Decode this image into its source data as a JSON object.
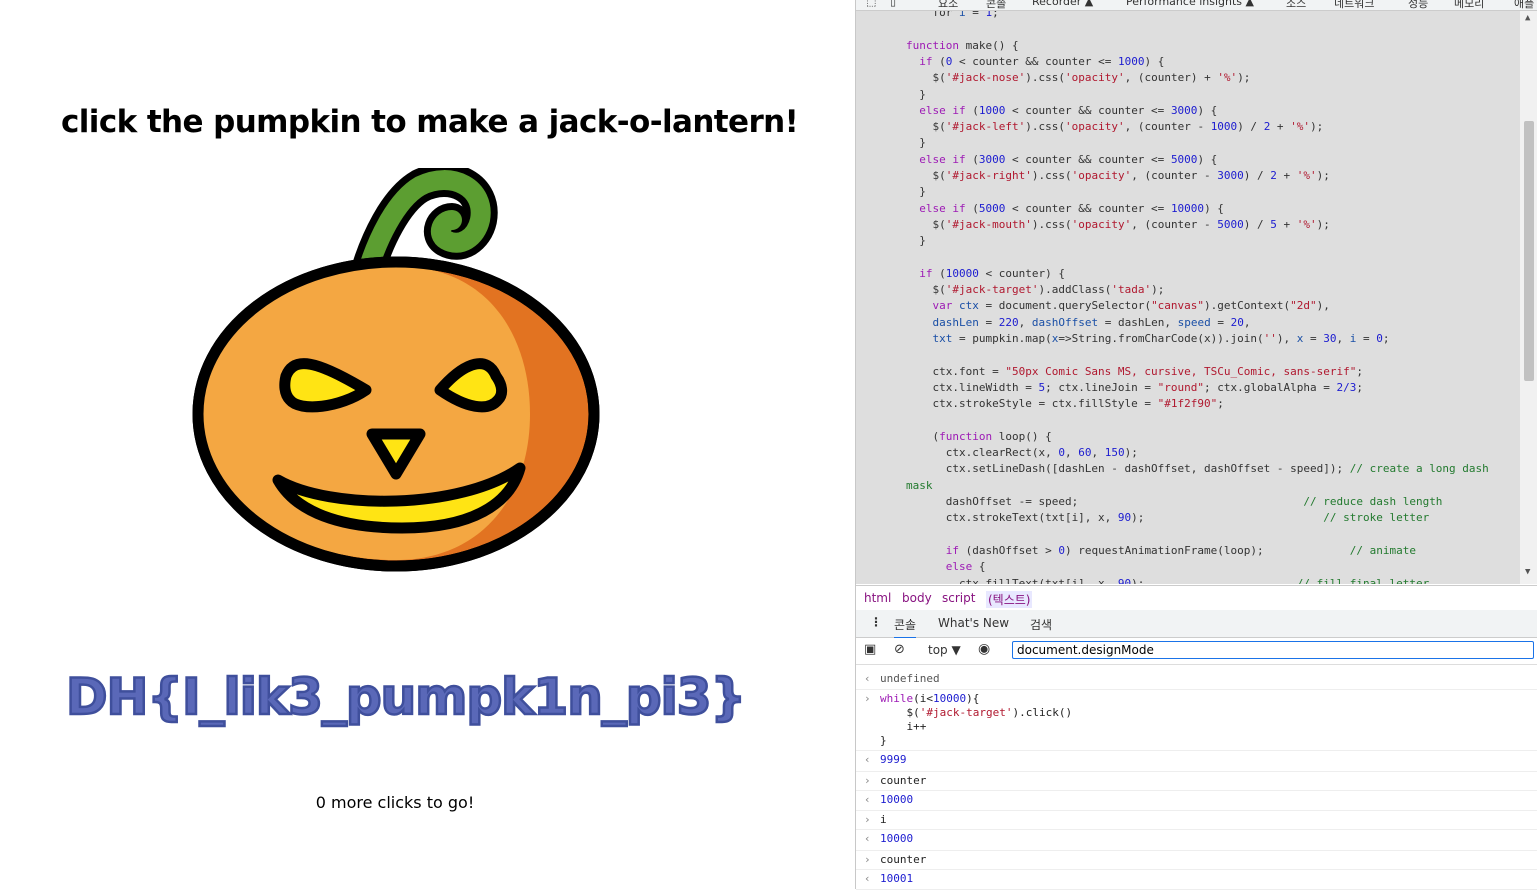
{
  "page": {
    "heading": "click the pumpkin to make a jack-o-lantern!",
    "flag_text": "DH{I_lik3_pumpk1n_pi3}",
    "clicks_text": "0 more clicks to go!",
    "colors": {
      "pumpkin_orange": "#f4a742",
      "pumpkin_shade": "#e27321",
      "stem_green": "#5c9e31",
      "eyes_yellow": "#ffe414",
      "outline": "#000000",
      "flag_color": "#1f2f90"
    }
  },
  "devtools": {
    "top_tabs": [
      "요소",
      "콘솔",
      "Recorder ▲",
      "Performance insights ▲",
      "소스",
      "네트워크",
      "성능",
      "메모리",
      "애플"
    ],
    "source_lines": [
      [
        {
          "t": "    for ",
          "c": ""
        },
        {
          "t": "i",
          "c": "vr"
        },
        {
          "t": " = ",
          "c": ""
        },
        {
          "t": "1",
          "c": "nu"
        },
        {
          "t": ";",
          "c": ""
        }
      ],
      [
        {
          "t": "",
          "c": ""
        }
      ],
      [
        {
          "t": "function",
          "c": "kw"
        },
        {
          "t": " make() {",
          "c": ""
        }
      ],
      [
        {
          "t": "  ",
          "c": ""
        },
        {
          "t": "if",
          "c": "kw"
        },
        {
          "t": " (",
          "c": ""
        },
        {
          "t": "0",
          "c": "nu"
        },
        {
          "t": " < counter && counter <= ",
          "c": ""
        },
        {
          "t": "1000",
          "c": "nu"
        },
        {
          "t": ") {",
          "c": ""
        }
      ],
      [
        {
          "t": "    $(",
          "c": ""
        },
        {
          "t": "'#jack-nose'",
          "c": "st"
        },
        {
          "t": ").css(",
          "c": ""
        },
        {
          "t": "'opacity'",
          "c": "st"
        },
        {
          "t": ", (counter) + ",
          "c": ""
        },
        {
          "t": "'%'",
          "c": "st"
        },
        {
          "t": ");",
          "c": ""
        }
      ],
      [
        {
          "t": "  }",
          "c": ""
        }
      ],
      [
        {
          "t": "  ",
          "c": ""
        },
        {
          "t": "else if",
          "c": "kw"
        },
        {
          "t": " (",
          "c": ""
        },
        {
          "t": "1000",
          "c": "nu"
        },
        {
          "t": " < counter && counter <= ",
          "c": ""
        },
        {
          "t": "3000",
          "c": "nu"
        },
        {
          "t": ") {",
          "c": ""
        }
      ],
      [
        {
          "t": "    $(",
          "c": ""
        },
        {
          "t": "'#jack-left'",
          "c": "st"
        },
        {
          "t": ").css(",
          "c": ""
        },
        {
          "t": "'opacity'",
          "c": "st"
        },
        {
          "t": ", (counter - ",
          "c": ""
        },
        {
          "t": "1000",
          "c": "nu"
        },
        {
          "t": ") / ",
          "c": ""
        },
        {
          "t": "2",
          "c": "nu"
        },
        {
          "t": " + ",
          "c": ""
        },
        {
          "t": "'%'",
          "c": "st"
        },
        {
          "t": ");",
          "c": ""
        }
      ],
      [
        {
          "t": "  }",
          "c": ""
        }
      ],
      [
        {
          "t": "  ",
          "c": ""
        },
        {
          "t": "else if",
          "c": "kw"
        },
        {
          "t": " (",
          "c": ""
        },
        {
          "t": "3000",
          "c": "nu"
        },
        {
          "t": " < counter && counter <= ",
          "c": ""
        },
        {
          "t": "5000",
          "c": "nu"
        },
        {
          "t": ") {",
          "c": ""
        }
      ],
      [
        {
          "t": "    $(",
          "c": ""
        },
        {
          "t": "'#jack-right'",
          "c": "st"
        },
        {
          "t": ").css(",
          "c": ""
        },
        {
          "t": "'opacity'",
          "c": "st"
        },
        {
          "t": ", (counter - ",
          "c": ""
        },
        {
          "t": "3000",
          "c": "nu"
        },
        {
          "t": ") / ",
          "c": ""
        },
        {
          "t": "2",
          "c": "nu"
        },
        {
          "t": " + ",
          "c": ""
        },
        {
          "t": "'%'",
          "c": "st"
        },
        {
          "t": ");",
          "c": ""
        }
      ],
      [
        {
          "t": "  }",
          "c": ""
        }
      ],
      [
        {
          "t": "  ",
          "c": ""
        },
        {
          "t": "else if",
          "c": "kw"
        },
        {
          "t": " (",
          "c": ""
        },
        {
          "t": "5000",
          "c": "nu"
        },
        {
          "t": " < counter && counter <= ",
          "c": ""
        },
        {
          "t": "10000",
          "c": "nu"
        },
        {
          "t": ") {",
          "c": ""
        }
      ],
      [
        {
          "t": "    $(",
          "c": ""
        },
        {
          "t": "'#jack-mouth'",
          "c": "st"
        },
        {
          "t": ").css(",
          "c": ""
        },
        {
          "t": "'opacity'",
          "c": "st"
        },
        {
          "t": ", (counter - ",
          "c": ""
        },
        {
          "t": "5000",
          "c": "nu"
        },
        {
          "t": ") / ",
          "c": ""
        },
        {
          "t": "5",
          "c": "nu"
        },
        {
          "t": " + ",
          "c": ""
        },
        {
          "t": "'%'",
          "c": "st"
        },
        {
          "t": ");",
          "c": ""
        }
      ],
      [
        {
          "t": "  }",
          "c": ""
        }
      ],
      [
        {
          "t": "",
          "c": ""
        }
      ],
      [
        {
          "t": "  ",
          "c": ""
        },
        {
          "t": "if",
          "c": "kw"
        },
        {
          "t": " (",
          "c": ""
        },
        {
          "t": "10000",
          "c": "nu"
        },
        {
          "t": " < counter) {",
          "c": ""
        }
      ],
      [
        {
          "t": "    $(",
          "c": ""
        },
        {
          "t": "'#jack-target'",
          "c": "st"
        },
        {
          "t": ").addClass(",
          "c": ""
        },
        {
          "t": "'tada'",
          "c": "st"
        },
        {
          "t": ");",
          "c": ""
        }
      ],
      [
        {
          "t": "    ",
          "c": ""
        },
        {
          "t": "var",
          "c": "kw"
        },
        {
          "t": " ",
          "c": ""
        },
        {
          "t": "ctx",
          "c": "vr"
        },
        {
          "t": " = document.querySelector(",
          "c": ""
        },
        {
          "t": "\"canvas\"",
          "c": "st"
        },
        {
          "t": ").getContext(",
          "c": ""
        },
        {
          "t": "\"2d\"",
          "c": "st"
        },
        {
          "t": "),",
          "c": ""
        }
      ],
      [
        {
          "t": "    ",
          "c": ""
        },
        {
          "t": "dashLen",
          "c": "vr"
        },
        {
          "t": " = ",
          "c": ""
        },
        {
          "t": "220",
          "c": "nu"
        },
        {
          "t": ", ",
          "c": ""
        },
        {
          "t": "dashOffset",
          "c": "vr"
        },
        {
          "t": " = dashLen, ",
          "c": ""
        },
        {
          "t": "speed",
          "c": "vr"
        },
        {
          "t": " = ",
          "c": ""
        },
        {
          "t": "20",
          "c": "nu"
        },
        {
          "t": ",",
          "c": ""
        }
      ],
      [
        {
          "t": "    ",
          "c": ""
        },
        {
          "t": "txt",
          "c": "vr"
        },
        {
          "t": " = pumpkin.map(",
          "c": ""
        },
        {
          "t": "x",
          "c": "vr"
        },
        {
          "t": "=>String.fromCharCode(x)).join(",
          "c": ""
        },
        {
          "t": "''",
          "c": "st"
        },
        {
          "t": "), ",
          "c": ""
        },
        {
          "t": "x",
          "c": "vr"
        },
        {
          "t": " = ",
          "c": ""
        },
        {
          "t": "30",
          "c": "nu"
        },
        {
          "t": ", ",
          "c": ""
        },
        {
          "t": "i",
          "c": "vr"
        },
        {
          "t": " = ",
          "c": ""
        },
        {
          "t": "0",
          "c": "nu"
        },
        {
          "t": ";",
          "c": ""
        }
      ],
      [
        {
          "t": "",
          "c": ""
        }
      ],
      [
        {
          "t": "    ctx.font = ",
          "c": ""
        },
        {
          "t": "\"50px Comic Sans MS, cursive, TSCu_Comic, sans-serif\"",
          "c": "st"
        },
        {
          "t": ";",
          "c": ""
        }
      ],
      [
        {
          "t": "    ctx.lineWidth = ",
          "c": ""
        },
        {
          "t": "5",
          "c": "nu"
        },
        {
          "t": "; ctx.lineJoin = ",
          "c": ""
        },
        {
          "t": "\"round\"",
          "c": "st"
        },
        {
          "t": "; ctx.globalAlpha = ",
          "c": ""
        },
        {
          "t": "2/3",
          "c": "nu"
        },
        {
          "t": ";",
          "c": ""
        }
      ],
      [
        {
          "t": "    ctx.strokeStyle = ctx.fillStyle = ",
          "c": ""
        },
        {
          "t": "\"#1f2f90\"",
          "c": "st"
        },
        {
          "t": ";",
          "c": ""
        }
      ],
      [
        {
          "t": "",
          "c": ""
        }
      ],
      [
        {
          "t": "    (",
          "c": ""
        },
        {
          "t": "function",
          "c": "kw"
        },
        {
          "t": " loop() {",
          "c": ""
        }
      ],
      [
        {
          "t": "      ctx.clearRect(x, ",
          "c": ""
        },
        {
          "t": "0",
          "c": "nu"
        },
        {
          "t": ", ",
          "c": ""
        },
        {
          "t": "60",
          "c": "nu"
        },
        {
          "t": ", ",
          "c": ""
        },
        {
          "t": "150",
          "c": "nu"
        },
        {
          "t": ");",
          "c": ""
        }
      ],
      [
        {
          "t": "      ctx.setLineDash([dashLen - dashOffset, dashOffset - speed]); ",
          "c": ""
        },
        {
          "t": "// create a long dash",
          "c": "cm"
        }
      ],
      [
        {
          "t": "mask",
          "c": "cm"
        }
      ],
      [
        {
          "t": "      dashOffset -= speed;                                  ",
          "c": ""
        },
        {
          "t": "// reduce dash length",
          "c": "cm"
        }
      ],
      [
        {
          "t": "      ctx.strokeText(txt[i], x, ",
          "c": ""
        },
        {
          "t": "90",
          "c": "nu"
        },
        {
          "t": ");                           ",
          "c": ""
        },
        {
          "t": "// stroke letter",
          "c": "cm"
        }
      ],
      [
        {
          "t": "",
          "c": ""
        }
      ],
      [
        {
          "t": "      ",
          "c": ""
        },
        {
          "t": "if",
          "c": "kw"
        },
        {
          "t": " (dashOffset > ",
          "c": ""
        },
        {
          "t": "0",
          "c": "nu"
        },
        {
          "t": ") requestAnimationFrame(loop);             ",
          "c": ""
        },
        {
          "t": "// animate",
          "c": "cm"
        }
      ],
      [
        {
          "t": "      ",
          "c": ""
        },
        {
          "t": "else",
          "c": "kw"
        },
        {
          "t": " {",
          "c": ""
        }
      ],
      [
        {
          "t": "        ctx.fillText(txt[i], x, ",
          "c": ""
        },
        {
          "t": "90",
          "c": "nu"
        },
        {
          "t": ");                       ",
          "c": ""
        },
        {
          "t": "// fill final letter",
          "c": "cm"
        }
      ]
    ],
    "breadcrumbs": [
      "html",
      "body",
      "script",
      "(텍스트)"
    ],
    "drawer_tabs": {
      "console": "콘솔",
      "whats_new": "What's New",
      "search": "검색"
    },
    "console_toolbar": {
      "context": "top",
      "filter_value": "document.designMode"
    },
    "console_rows": [
      {
        "dir": "out",
        "text": "undefined",
        "style": "muted"
      },
      {
        "dir": "in",
        "code": [
          [
            {
              "t": "while",
              "c": "kw"
            },
            {
              "t": "(i<",
              "c": ""
            },
            {
              "t": "10000",
              "c": "nu"
            },
            {
              "t": "){",
              "c": ""
            }
          ],
          [
            {
              "t": "    $(",
              "c": ""
            },
            {
              "t": "'#jack-target'",
              "c": "st"
            },
            {
              "t": ").click()",
              "c": ""
            }
          ],
          [
            {
              "t": "    i++",
              "c": ""
            }
          ],
          [
            {
              "t": "}",
              "c": ""
            }
          ]
        ]
      },
      {
        "dir": "out",
        "text": "9999",
        "style": "res"
      },
      {
        "dir": "in",
        "text": "counter",
        "style": ""
      },
      {
        "dir": "out",
        "text": "10000",
        "style": "res"
      },
      {
        "dir": "in",
        "text": "i",
        "style": ""
      },
      {
        "dir": "out",
        "text": "10000",
        "style": "res"
      },
      {
        "dir": "in",
        "text": "counter",
        "style": ""
      },
      {
        "dir": "out",
        "text": "10001",
        "style": "res"
      }
    ]
  }
}
